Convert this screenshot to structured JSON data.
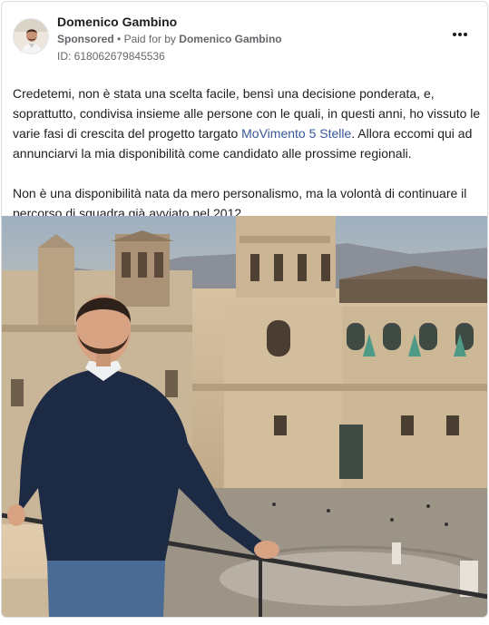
{
  "post": {
    "page_name": "Domenico Gambino",
    "sponsored_label": "Sponsored",
    "separator": "•",
    "paid_for_prefix": "Paid for by",
    "paid_for_name": "Domenico Gambino",
    "ad_id": "ID: 618062679845536",
    "paragraph1_before": "Credetemi, non è stata una scelta facile, bensì una decisione ponderata, e, soprattutto, condivisa insieme alle persone con le quali, in questi anni, ho vissuto le varie fasi di crescita del progetto targato ",
    "paragraph1_link": "MoVimento 5 Stelle",
    "paragraph1_after": ". Allora eccomi qui ad annunciarvi la mia disponibilità come candidato alle prossime regionali.",
    "paragraph2": "Non è una disponibilità nata da mero personalismo, ma la volontà di continuare il percorso di squadra già avviato nel 2012.…"
  },
  "icons": {
    "more": "more-horizontal-icon"
  },
  "colors": {
    "link": "#385898",
    "muted_text": "#65676b",
    "border": "#dadde1"
  }
}
